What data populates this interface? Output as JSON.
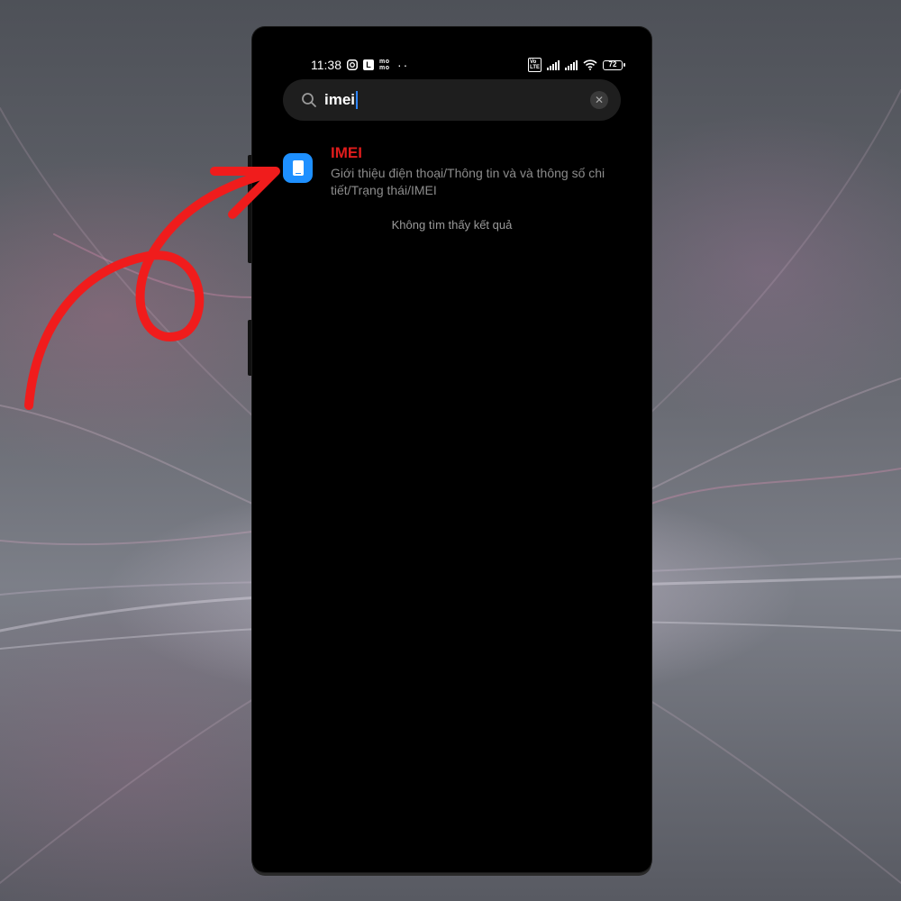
{
  "status_bar": {
    "time": "11:38",
    "left_icons": [
      "instagram-icon",
      "l-app-icon",
      "momo-icon",
      "more-dots-icon"
    ],
    "momo_label": "mo mo",
    "dots": "··",
    "battery_level": "72",
    "right_icons": [
      "volte-icon",
      "signal-icon",
      "signal-icon",
      "wifi-icon",
      "battery-icon"
    ]
  },
  "search": {
    "value": "imei",
    "icon": "search-icon",
    "clear_icon": "close-icon"
  },
  "results": [
    {
      "title": "IMEI",
      "path": "Giới thiệu điện thoại/Thông tin và và thông số chi tiết/Trạng thái/IMEI",
      "icon": "phone-info-icon",
      "title_color": "#e01c1c"
    }
  ],
  "no_result_text": "Không tìm thấy kết quả",
  "colors": {
    "accent_icon": "#1e90ff",
    "annotation_arrow": "#f01c1c",
    "caret": "#2f86ff"
  }
}
